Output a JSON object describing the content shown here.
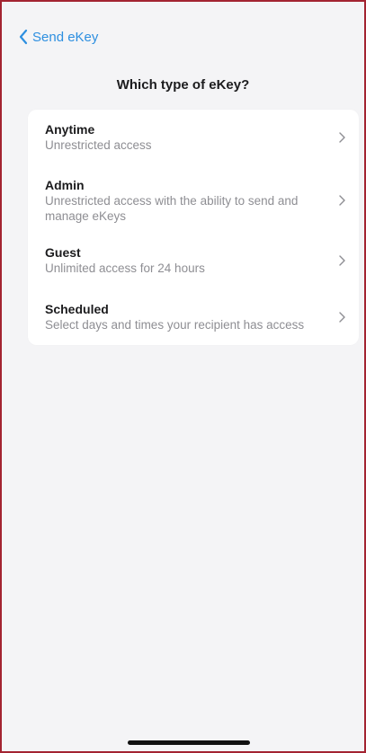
{
  "nav": {
    "back_label": "Send eKey"
  },
  "page": {
    "title": "Which type of eKey?"
  },
  "options": [
    {
      "title": "Anytime",
      "description": "Unrestricted access"
    },
    {
      "title": "Admin",
      "description": "Unrestricted access with the ability to send and manage eKeys"
    },
    {
      "title": "Guest",
      "description": "Unlimited access for 24 hours"
    },
    {
      "title": "Scheduled",
      "description": "Select days and times your recipient has access"
    }
  ],
  "colors": {
    "accent": "#2d8fe0",
    "frame_border": "#a32431",
    "background": "#f4f4f6",
    "card": "#ffffff",
    "secondary_text": "#8e8e93"
  },
  "icons": {
    "back": "chevron-left-icon",
    "row": "chevron-right-icon"
  }
}
